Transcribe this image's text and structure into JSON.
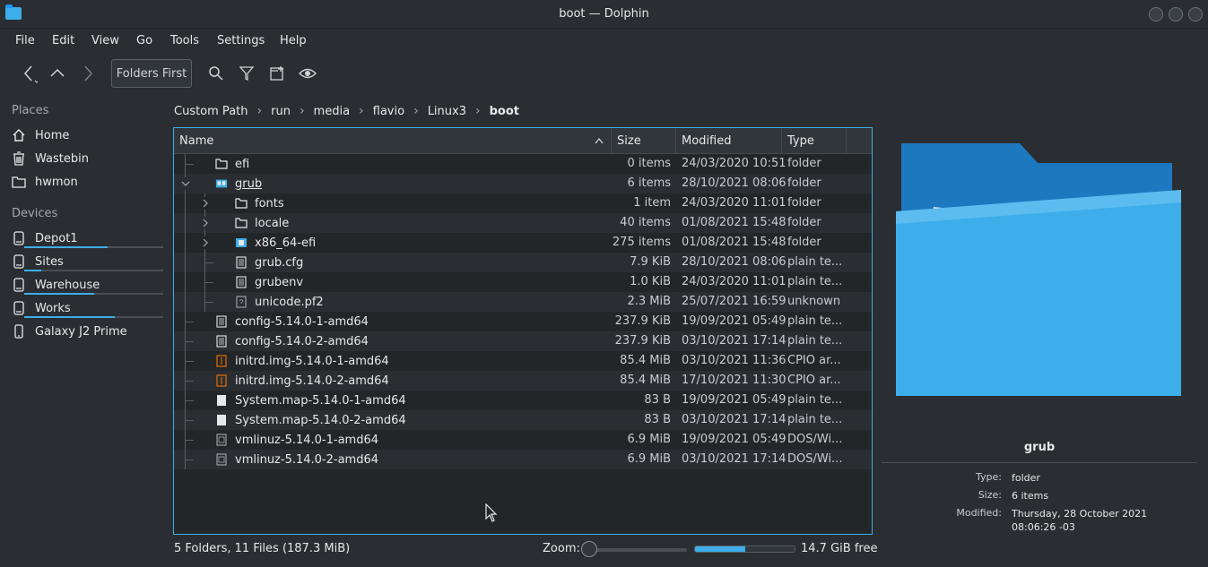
{
  "window": {
    "title": "boot — Dolphin"
  },
  "menu": [
    "File",
    "Edit",
    "View",
    "Go",
    "Tools",
    "Settings",
    "Help"
  ],
  "toolbar": {
    "folders_first": "Folders First",
    "icons": [
      "back-icon",
      "up-icon",
      "forward-icon",
      "search-icon",
      "filter-icon",
      "new-tab-icon",
      "preview-icon"
    ]
  },
  "sidebar": {
    "places_title": "Places",
    "places": [
      {
        "label": "Home",
        "icon": "home-icon"
      },
      {
        "label": "Wastebin",
        "icon": "trash-icon"
      },
      {
        "label": "hwmon",
        "icon": "folder-icon"
      }
    ],
    "devices_title": "Devices",
    "devices": [
      {
        "label": "Depot1",
        "icon": "drive-icon",
        "usage": 0.6
      },
      {
        "label": "Sites",
        "icon": "drive-icon",
        "usage": 0.12
      },
      {
        "label": "Warehouse",
        "icon": "drive-icon",
        "usage": 0.5
      },
      {
        "label": "Works",
        "icon": "drive-icon",
        "usage": 0.65
      },
      {
        "label": "Galaxy J2 Prime",
        "icon": "phone-icon"
      }
    ]
  },
  "breadcrumb": [
    "Custom Path",
    "run",
    "media",
    "flavio",
    "Linux3",
    "boot"
  ],
  "columns": {
    "name": "Name",
    "size": "Size",
    "modified": "Modified",
    "type": "Type"
  },
  "files": [
    {
      "name": "efi",
      "size": "0 items",
      "modified": "24/03/2020 10:51",
      "type": "folder",
      "kind": "folder",
      "depth": 0
    },
    {
      "name": "grub",
      "size": "6 items",
      "modified": "28/10/2021 08:06",
      "type": "folder",
      "kind": "folder-open",
      "depth": 0,
      "expanded": true
    },
    {
      "name": "fonts",
      "size": "1 item",
      "modified": "24/03/2020 11:01",
      "type": "folder",
      "kind": "folder",
      "depth": 1,
      "expandable": true
    },
    {
      "name": "locale",
      "size": "40 items",
      "modified": "01/08/2021 15:48",
      "type": "folder",
      "kind": "folder",
      "depth": 1,
      "expandable": true
    },
    {
      "name": "x86_64-efi",
      "size": "275 items",
      "modified": "01/08/2021 15:48",
      "type": "folder",
      "kind": "folder-blue",
      "depth": 1,
      "expandable": true
    },
    {
      "name": "grub.cfg",
      "size": "7.9 KiB",
      "modified": "28/10/2021 08:06",
      "type": "plain te...",
      "kind": "text",
      "depth": 1
    },
    {
      "name": "grubenv",
      "size": "1.0 KiB",
      "modified": "24/03/2020 11:01",
      "type": "plain te...",
      "kind": "text",
      "depth": 1
    },
    {
      "name": "unicode.pf2",
      "size": "2.3 MiB",
      "modified": "25/07/2021 16:59",
      "type": "unknown",
      "kind": "unknown",
      "depth": 1
    },
    {
      "name": "config-5.14.0-1-amd64",
      "size": "237.9 KiB",
      "modified": "19/09/2021 05:49",
      "type": "plain te...",
      "kind": "text",
      "depth": 0
    },
    {
      "name": "config-5.14.0-2-amd64",
      "size": "237.9 KiB",
      "modified": "03/10/2021 17:14",
      "type": "plain te...",
      "kind": "text",
      "depth": 0
    },
    {
      "name": "initrd.img-5.14.0-1-amd64",
      "size": "85.4 MiB",
      "modified": "03/10/2021 11:36",
      "type": "CPIO ar...",
      "kind": "archive",
      "depth": 0
    },
    {
      "name": "initrd.img-5.14.0-2-amd64",
      "size": "85.4 MiB",
      "modified": "17/10/2021 11:30",
      "type": "CPIO ar...",
      "kind": "archive",
      "depth": 0
    },
    {
      "name": "System.map-5.14.0-1-amd64",
      "size": "83 B",
      "modified": "19/09/2021 05:49",
      "type": "plain te...",
      "kind": "text-white",
      "depth": 0
    },
    {
      "name": "System.map-5.14.0-2-amd64",
      "size": "83 B",
      "modified": "03/10/2021 17:14",
      "type": "plain te...",
      "kind": "text-white",
      "depth": 0
    },
    {
      "name": "vmlinuz-5.14.0-1-amd64",
      "size": "6.9 MiB",
      "modified": "19/09/2021 05:49",
      "type": "DOS/Wi...",
      "kind": "binary",
      "depth": 0
    },
    {
      "name": "vmlinuz-5.14.0-2-amd64",
      "size": "6.9 MiB",
      "modified": "03/10/2021 17:14",
      "type": "DOS/Wi...",
      "kind": "binary",
      "depth": 0
    }
  ],
  "info": {
    "name": "grub",
    "type_label": "Type:",
    "type_value": "folder",
    "size_label": "Size:",
    "size_value": "6 items",
    "modified_label": "Modified:",
    "modified_value": "Thursday, 28 October 2021 08:06:26 -03"
  },
  "status": {
    "summary": "5 Folders, 11 Files (187.3 MiB)",
    "zoom_label": "Zoom:",
    "free_space": "14.7 GiB free",
    "used_fraction": 0.5
  },
  "colors": {
    "accent": "#3daee9",
    "folder": "#1d99f3",
    "background": "#2a2e32"
  }
}
